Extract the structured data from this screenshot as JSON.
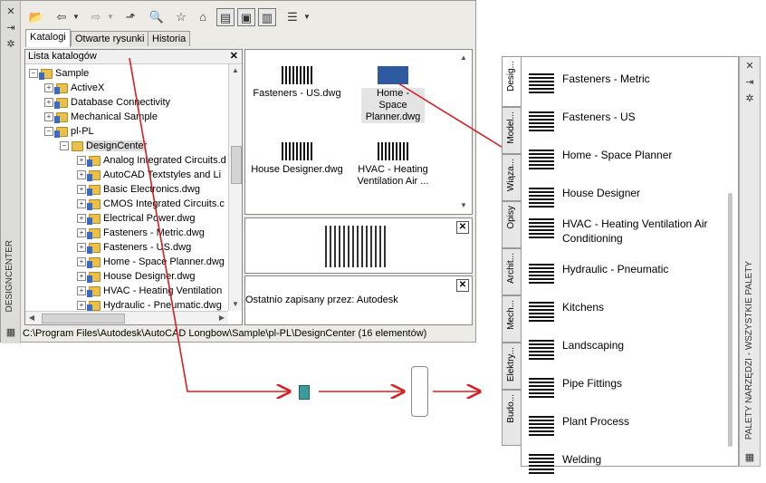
{
  "designcenter": {
    "side_title": "DESIGNCENTER",
    "tabs": [
      "Katalogi",
      "Otwarte rysunki",
      "Historia"
    ],
    "tree": {
      "header": "Lista katalogów",
      "items": [
        {
          "label": "Sample",
          "level": 1
        },
        {
          "label": "ActiveX",
          "level": 2
        },
        {
          "label": "Database Connectivity",
          "level": 2
        },
        {
          "label": "Mechanical Sample",
          "level": 2
        },
        {
          "label": "pl-PL",
          "level": 2
        },
        {
          "label": "DesignCenter",
          "level": 3
        },
        {
          "label": "Analog Integrated Circuits.d",
          "level": 4
        },
        {
          "label": "AutoCAD Textstyles and Li",
          "level": 4
        },
        {
          "label": "Basic Electronics.dwg",
          "level": 4
        },
        {
          "label": "CMOS Integrated Circuits.c",
          "level": 4
        },
        {
          "label": "Electrical Power.dwg",
          "level": 4
        },
        {
          "label": "Fasteners - Metric.dwg",
          "level": 4
        },
        {
          "label": "Fasteners - US.dwg",
          "level": 4
        },
        {
          "label": "Home - Space Planner.dwg",
          "level": 4
        },
        {
          "label": "House Designer.dwg",
          "level": 4
        },
        {
          "label": "HVAC - Heating Ventilation",
          "level": 4
        },
        {
          "label": "Hydraulic - Pneumatic.dwg",
          "level": 4
        }
      ]
    },
    "content_items": [
      {
        "label": "Fasteners - US.dwg"
      },
      {
        "label": "Home - Space Planner.dwg"
      },
      {
        "label": "House Designer.dwg"
      },
      {
        "label": "HVAC - Heating Ventilation Air ..."
      }
    ],
    "description": "Ostatnio zapisany przez: Autodesk",
    "status_path": "C:\\Program Files\\Autodesk\\AutoCAD Longbow\\Sample\\pl-PL\\DesignCenter (16 elementów)"
  },
  "tool_palette": {
    "side_title": "PALETY NARZĘDZI - WSZYSTKIE PALETY",
    "tabs": [
      "Desig...",
      "Model...",
      "Wiąza...",
      "Opisy",
      "Archit...",
      "Mech...",
      "Elektry...",
      "Budo..."
    ],
    "items": [
      "Fasteners - Metric",
      "Fasteners - US",
      "Home - Space Planner",
      "House Designer",
      "HVAC - Heating Ventilation Air Conditioning",
      "Hydraulic - Pneumatic",
      "Kitchens",
      "Landscaping",
      "Pipe Fittings",
      "Plant Process",
      "Welding"
    ]
  },
  "colors": {
    "arrow": "#d81e1e",
    "selection": "#2d5aa0"
  }
}
